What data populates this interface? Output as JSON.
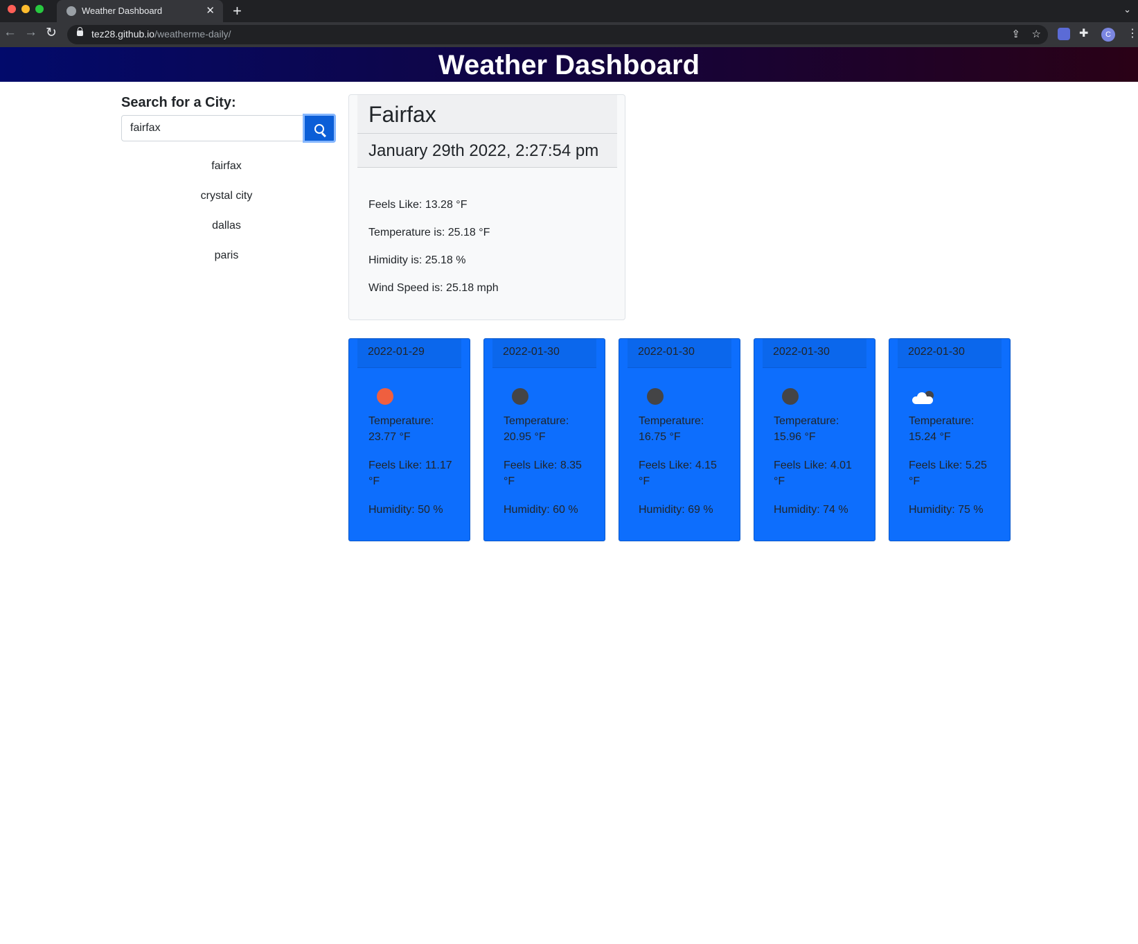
{
  "browser": {
    "tab_title": "Weather Dashboard",
    "url_host": "tez28.github.io",
    "url_path": "/weatherme-daily/",
    "profile_initial": "C"
  },
  "page": {
    "title": "Weather Dashboard"
  },
  "search": {
    "label": "Search for a City:",
    "value": "fairfax"
  },
  "history": [
    "fairfax",
    "crystal city",
    "dallas",
    "paris"
  ],
  "current": {
    "city": "Fairfax",
    "datetime": "January 29th 2022, 2:27:54 pm",
    "feels_like": "Feels Like: 13.28 °F",
    "temperature": "Temperature is: 25.18 °F",
    "humidity": "Himidity is: 25.18 %",
    "wind": "Wind Speed is: 25.18 mph"
  },
  "forecast": [
    {
      "date": "2022-01-29",
      "icon": "sun-icon",
      "temperature": "Temperature: 23.77 °F",
      "feels_like": "Feels Like: 11.17 °F",
      "humidity": "Humidity: 50 %"
    },
    {
      "date": "2022-01-30",
      "icon": "night-icon",
      "temperature": "Temperature: 20.95 °F",
      "feels_like": "Feels Like: 8.35 °F",
      "humidity": "Humidity: 60 %"
    },
    {
      "date": "2022-01-30",
      "icon": "night-icon",
      "temperature": "Temperature: 16.75 °F",
      "feels_like": "Feels Like: 4.15 °F",
      "humidity": "Humidity: 69 %"
    },
    {
      "date": "2022-01-30",
      "icon": "night-icon",
      "temperature": "Temperature: 15.96 °F",
      "feels_like": "Feels Like: 4.01 °F",
      "humidity": "Humidity: 74 %"
    },
    {
      "date": "2022-01-30",
      "icon": "cloud-night-icon",
      "temperature": "Temperature: 15.24 °F",
      "feels_like": "Feels Like: 5.25 °F",
      "humidity": "Humidity: 75 %"
    }
  ],
  "colors": {
    "forecast_card": "#0d6efd",
    "sun_icon": "#ef5f3f",
    "header_start": "#020a6b",
    "header_end": "#2a0116"
  }
}
